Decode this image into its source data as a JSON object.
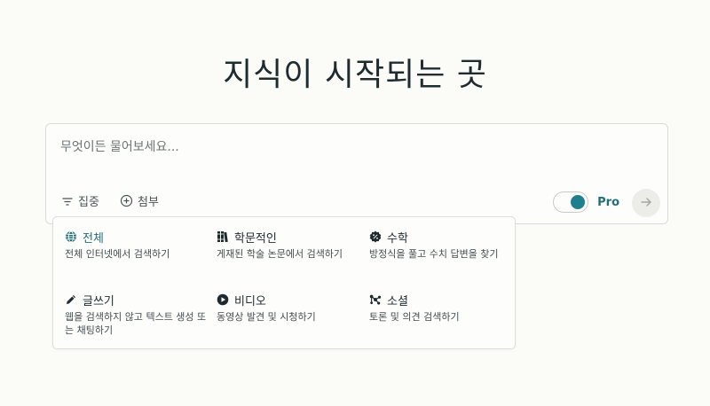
{
  "hero": {
    "title": "지식이 시작되는 곳"
  },
  "search": {
    "placeholder": "무엇이든 물어보세요...",
    "focus_label": "집중",
    "attach_label": "첨부",
    "pro_label": "Pro",
    "pro_enabled": true
  },
  "focus_menu": {
    "items": [
      {
        "label": "전체",
        "description": "전체 인터넷에서 검색하기",
        "icon": "globe-icon",
        "selected": true
      },
      {
        "label": "학문적인",
        "description": "게재된 학술 논문에서 검색하기",
        "icon": "books-icon",
        "selected": false
      },
      {
        "label": "수학",
        "description": "방정식을 풀고 수치 답변을 찾기",
        "icon": "percent-badge-icon",
        "selected": false
      },
      {
        "label": "글쓰기",
        "description": "웹을 검색하지 않고 텍스트 생성 또는 채팅하기",
        "icon": "pencil-icon",
        "selected": false
      },
      {
        "label": "비디오",
        "description": "동영상 발견 및 시청하기",
        "icon": "play-circle-icon",
        "selected": false
      },
      {
        "label": "소셜",
        "description": "토론 및 의견 검색하기",
        "icon": "network-icon",
        "selected": false
      }
    ]
  },
  "colors": {
    "background": "#fbfbf7",
    "accent": "#1f7f8c",
    "text": "#1f2a2e"
  }
}
